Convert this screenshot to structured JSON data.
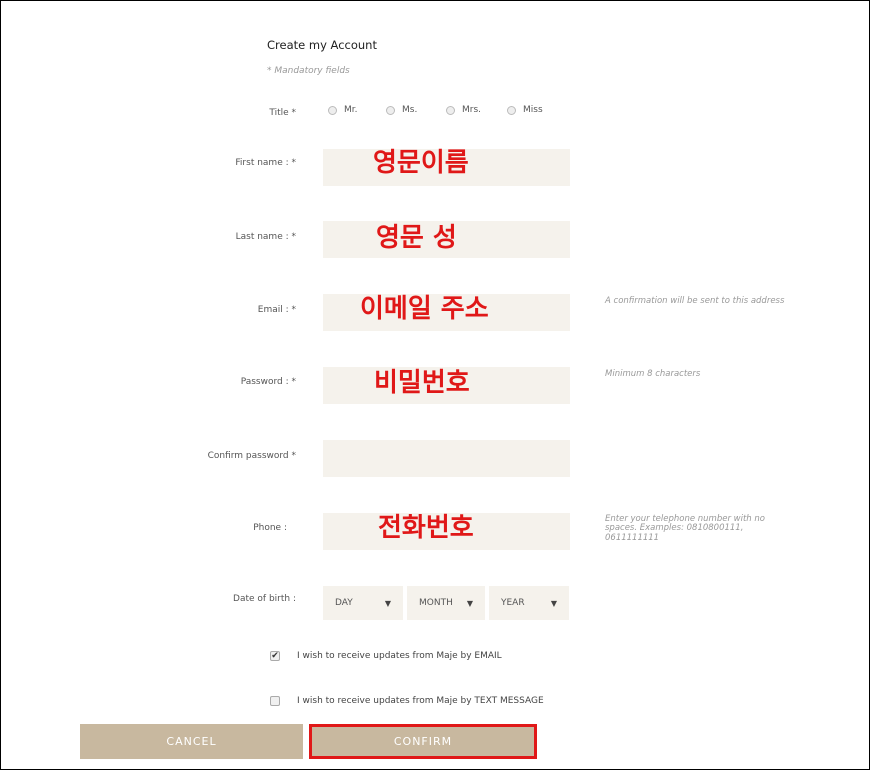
{
  "form": {
    "title": "Create my Account",
    "mandatory_note": "* Mandatory fields",
    "title_field": {
      "label": "Title *",
      "options": [
        "Mr.",
        "Ms.",
        "Mrs.",
        "Miss"
      ]
    },
    "first_name": {
      "label": "First name : *",
      "overlay": "영문이름"
    },
    "last_name": {
      "label": "Last name : *",
      "overlay": "영문 성"
    },
    "email": {
      "label": "Email : *",
      "overlay": "이메일 주소",
      "hint": "A confirmation will be sent to this address"
    },
    "password": {
      "label": "Password : *",
      "overlay": "비밀번호",
      "hint": "Minimum 8 characters"
    },
    "confirm_password": {
      "label": "Confirm password *"
    },
    "phone": {
      "label": "Phone :",
      "overlay": "전화번호",
      "hint": "Enter your telephone number with no spaces. Examples: 0810800111, 0611111111"
    },
    "dob": {
      "label": "Date of birth :",
      "day": "DAY",
      "month": "MONTH",
      "year": "YEAR"
    },
    "updates_email": {
      "label": "I wish to receive updates from Maje by EMAIL",
      "checked": true
    },
    "updates_sms": {
      "label": "I wish to receive updates from Maje by TEXT MESSAGE",
      "checked": false
    }
  },
  "buttons": {
    "cancel": "CANCEL",
    "confirm": "CONFIRM"
  },
  "colors": {
    "field_bg": "#f5f2ec",
    "button_bg": "#c8b89f",
    "highlight": "#e01818"
  }
}
